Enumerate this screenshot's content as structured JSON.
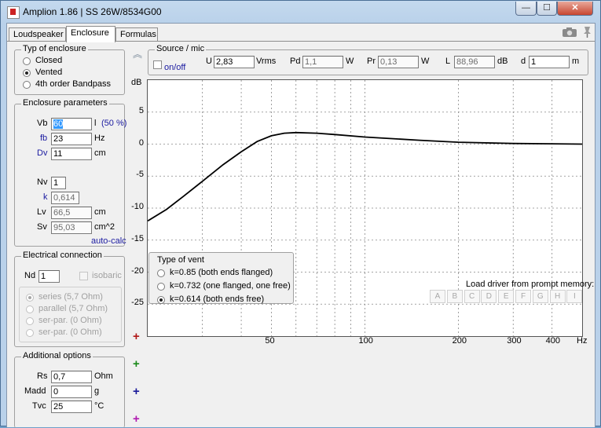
{
  "window": {
    "title": "Amplion 1.86 | SS 26W/8534G00",
    "min": "—",
    "max": "☐",
    "close": "✕"
  },
  "tabs": [
    {
      "label": "Loudspeaker"
    },
    {
      "label": "Enclosure"
    },
    {
      "label": "Formulas"
    }
  ],
  "toolbar": {
    "camera_icon": "camera-icon",
    "pin_icon": "pin-icon"
  },
  "enclosure_type": {
    "title": "Typ of enclosure",
    "options": [
      {
        "label": "Closed",
        "selected": false
      },
      {
        "label": "Vented",
        "selected": true
      },
      {
        "label": "4th order Bandpass",
        "selected": false
      }
    ]
  },
  "params": {
    "title": "Enclosure parameters",
    "vb_label": "Vb",
    "vb_value": "60",
    "vb_unit": "l",
    "vb_pct": "(50 %)",
    "fb_label": "fb",
    "fb_value": "23",
    "fb_unit": "Hz",
    "dv_label": "Dv",
    "dv_value": "11",
    "dv_unit": "cm",
    "nv_label": "Nv",
    "nv_value": "1",
    "k_label": "k",
    "k_value": "0,614",
    "lv_label": "Lv",
    "lv_value": "66,5",
    "lv_unit": "cm",
    "sv_label": "Sv",
    "sv_value": "95,03",
    "sv_unit": "cm^2",
    "autocalc": "auto-calc"
  },
  "electrical": {
    "title": "Electrical connection",
    "nd_label": "Nd",
    "nd_value": "1",
    "isobaric": "isobaric",
    "options": [
      {
        "label": "series (5,7 Ohm)",
        "selected": true
      },
      {
        "label": "parallel (5,7 Ohm)",
        "selected": false
      },
      {
        "label": "ser-par. (0 Ohm)",
        "selected": false
      },
      {
        "label": "ser-par. (0 Ohm)",
        "selected": false
      }
    ]
  },
  "additional": {
    "title": "Additional options",
    "rs_label": "Rs",
    "rs_value": "0,7",
    "rs_unit": "Ohm",
    "madd_label": "Madd",
    "madd_value": "0",
    "madd_unit": "g",
    "tvc_label": "Tvc",
    "tvc_value": "25",
    "tvc_unit": "°C"
  },
  "plus_buttons": [
    {
      "label": "+",
      "color": "#b01818"
    },
    {
      "label": "+",
      "color": "#1a8a1a"
    },
    {
      "label": "+",
      "color": "#1a1a9a"
    },
    {
      "label": "+",
      "color": "#b01ab0"
    }
  ],
  "collapse_label": "︽",
  "source": {
    "title": "Source / mic",
    "onoff": "on/off",
    "u_label": "U",
    "u_value": "2,83",
    "u_unit": "Vrms",
    "pd_label": "Pd",
    "pd_value": "1,1",
    "pd_unit": "W",
    "pr_label": "Pr",
    "pr_value": "0,13",
    "pr_unit": "W",
    "l_label": "L",
    "l_value": "88,96",
    "l_unit": "dB",
    "d_label": "d",
    "d_value": "1",
    "d_unit": "m"
  },
  "vent_type": {
    "title": "Type of vent",
    "options": [
      {
        "label": "k=0.85 (both ends flanged)",
        "selected": false
      },
      {
        "label": "k=0.732 (one flanged, one free)",
        "selected": false
      },
      {
        "label": "k=0.614 (both ends free)",
        "selected": true
      }
    ]
  },
  "memory": {
    "title": "Load driver from prompt memory:",
    "slots": [
      "A",
      "B",
      "C",
      "D",
      "E",
      "F",
      "G",
      "H",
      "I"
    ]
  },
  "chart_data": {
    "type": "line",
    "title": "",
    "xlabel": "Hz",
    "ylabel": "dB",
    "xscale": "log",
    "xlim": [
      20,
      500
    ],
    "ylim": [
      -30,
      10
    ],
    "xticks": [
      50,
      100,
      200,
      300,
      400
    ],
    "yticks": [
      5,
      0,
      -5,
      -10,
      -15,
      -20,
      -25
    ],
    "grid": true,
    "series": [
      {
        "x": [
          20,
          23,
          26,
          30,
          35,
          40,
          45,
          50,
          55,
          60,
          70,
          80,
          100,
          150,
          200,
          300,
          400,
          500
        ],
        "y": [
          -12.0,
          -10.2,
          -8.2,
          -5.8,
          -3.2,
          -1.2,
          0.4,
          1.3,
          1.7,
          1.8,
          1.7,
          1.5,
          1.1,
          0.6,
          0.3,
          0.1,
          0.05,
          0.0
        ]
      }
    ]
  }
}
